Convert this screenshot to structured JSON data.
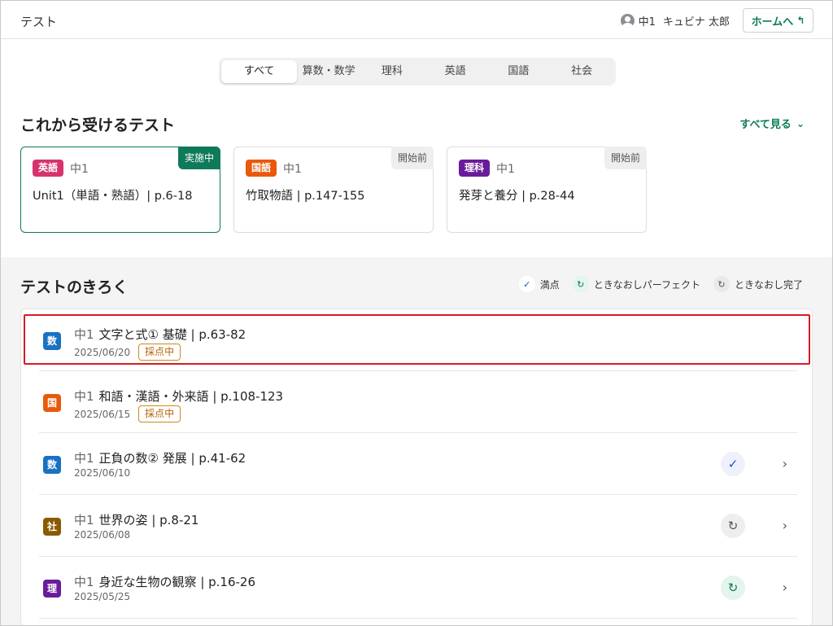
{
  "header": {
    "title": "テスト",
    "user_grade": "中1",
    "user_name": "キュビナ 太郎",
    "home_label": "ホームへ",
    "home_icon": "return-arrow-icon"
  },
  "tabs": [
    {
      "label": "すべて",
      "active": true
    },
    {
      "label": "算数・数学",
      "active": false
    },
    {
      "label": "理科",
      "active": false
    },
    {
      "label": "英語",
      "active": false
    },
    {
      "label": "国語",
      "active": false
    },
    {
      "label": "社会",
      "active": false
    }
  ],
  "upcoming": {
    "title": "これから受けるテスト",
    "see_all": "すべて見る",
    "cards": [
      {
        "subject": "英語",
        "color": "#d6336c",
        "grade": "中1",
        "name": "Unit1（単語・熟語）| p.6-18",
        "status": "実施中",
        "status_type": "live"
      },
      {
        "subject": "国語",
        "color": "#e8590c",
        "grade": "中1",
        "name": "竹取物語 | p.147-155",
        "status": "開始前",
        "status_type": "wait"
      },
      {
        "subject": "理科",
        "color": "#6a1b9a",
        "grade": "中1",
        "name": "発芽と養分 | p.28-44",
        "status": "開始前",
        "status_type": "wait"
      }
    ]
  },
  "history": {
    "title": "テストのきろく",
    "legend": [
      {
        "icon": "check-badge-icon",
        "label": "満点"
      },
      {
        "icon": "redo-perfect-icon",
        "label": "ときなおしパーフェクト"
      },
      {
        "icon": "redo-done-icon",
        "label": "ときなおし完了"
      }
    ],
    "items": [
      {
        "subject": "数",
        "color": "#1971c2",
        "grade": "中1",
        "name": "文字と式① 基礎 | p.63-82",
        "date": "2025/06/20",
        "tag": "採点中",
        "result": null
      },
      {
        "subject": "国",
        "color": "#e8590c",
        "grade": "中1",
        "name": "和語・漢語・外来語 | p.108-123",
        "date": "2025/06/15",
        "tag": "採点中",
        "result": null
      },
      {
        "subject": "数",
        "color": "#1971c2",
        "grade": "中1",
        "name": "正負の数② 発展 | p.41-62",
        "date": "2025/06/10",
        "tag": null,
        "result": "full"
      },
      {
        "subject": "社",
        "color": "#8a5a00",
        "grade": "中1",
        "name": "世界の姿 | p.8-21",
        "date": "2025/06/08",
        "tag": null,
        "result": "done"
      },
      {
        "subject": "理",
        "color": "#6a1b9a",
        "grade": "中1",
        "name": "身近な生物の観察 | p.16-26",
        "date": "2025/05/25",
        "tag": null,
        "result": "perfect"
      }
    ]
  }
}
